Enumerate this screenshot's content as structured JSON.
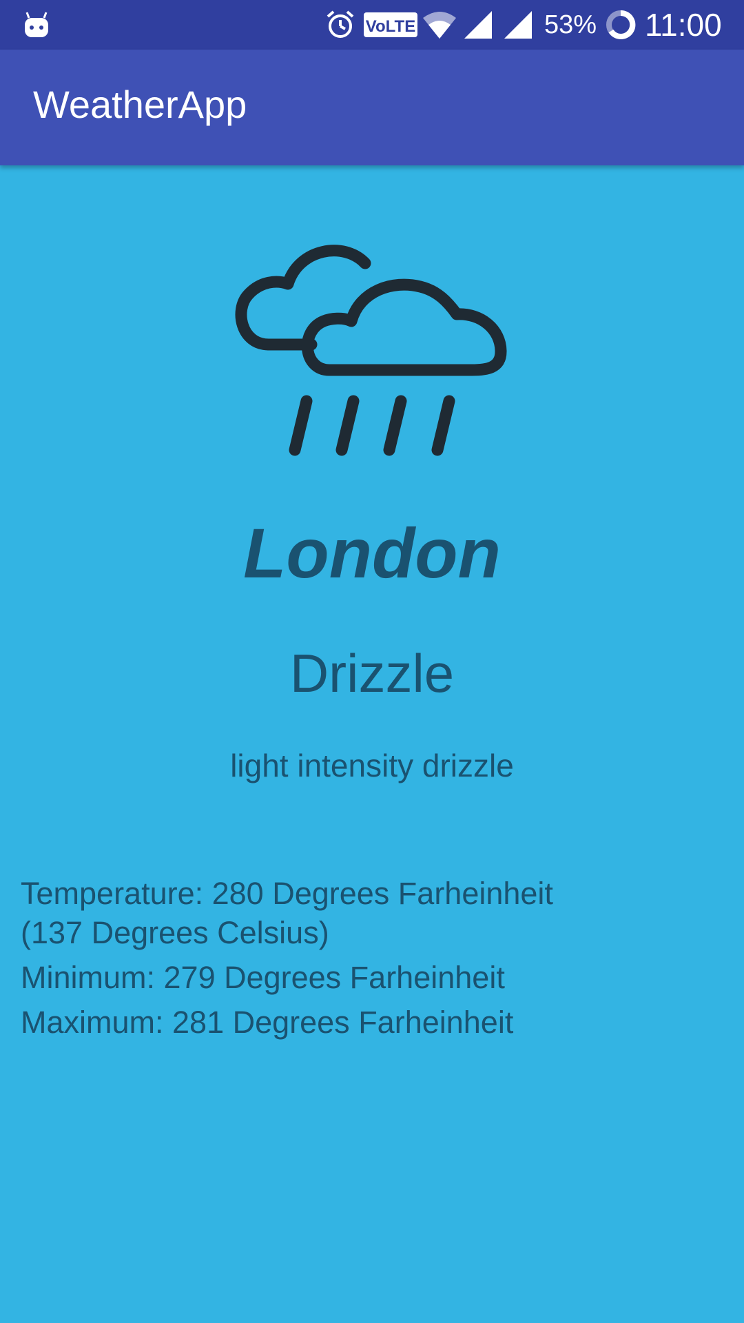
{
  "status_bar": {
    "battery_percent": "53%",
    "time": "11:00",
    "volte_label": "VoLTE",
    "icons": [
      "android-icon",
      "alarm-icon",
      "volte-icon",
      "wifi-icon",
      "signal-icon",
      "signal-icon",
      "battery-saver-icon"
    ]
  },
  "app_bar": {
    "title": "WeatherApp"
  },
  "weather": {
    "icon": "drizzle-cloud-icon",
    "city": "London",
    "condition": "Drizzle",
    "description": "light intensity drizzle",
    "temperature_line1": "Temperature: 280 Degrees Farheinheit",
    "temperature_line2": "(137 Degrees Celsius)",
    "minimum": "Minimum: 279 Degrees Farheinheit",
    "maximum": "Maximum: 281 Degrees Farheinheit"
  },
  "colors": {
    "status_bar": "#303f9f",
    "app_bar": "#3f51b5",
    "background": "#33b4e3",
    "text": "#1a5270",
    "icon_stroke": "#1f2a33"
  }
}
